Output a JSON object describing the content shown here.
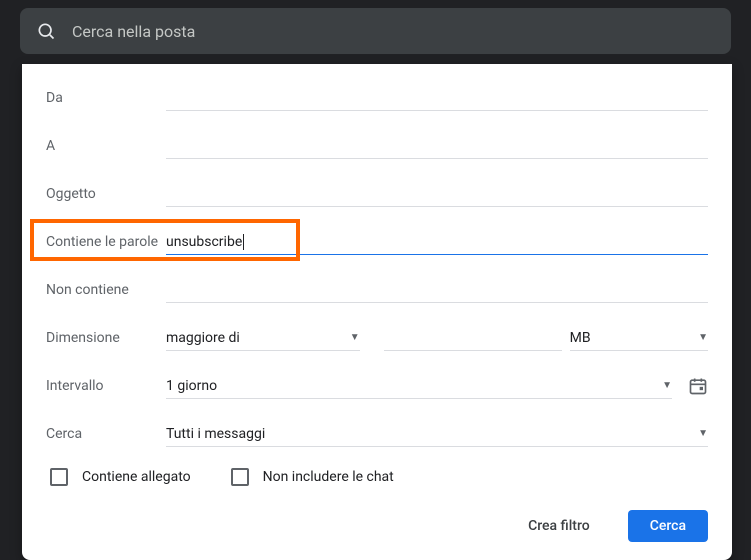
{
  "search": {
    "placeholder": "Cerca nella posta"
  },
  "form": {
    "from": {
      "label": "Da",
      "value": ""
    },
    "to": {
      "label": "A",
      "value": ""
    },
    "subject": {
      "label": "Oggetto",
      "value": ""
    },
    "has_words": {
      "label": "Contiene le parole",
      "value": "unsubscribe"
    },
    "not_has": {
      "label": "Non contiene",
      "value": ""
    },
    "size": {
      "label": "Dimensione",
      "operator": "maggiore di",
      "value": "",
      "unit": "MB"
    },
    "interval": {
      "label": "Intervallo",
      "value": "1 giorno"
    },
    "search_in": {
      "label": "Cerca",
      "value": "Tutti i messaggi"
    },
    "has_attachment": {
      "label": "Contiene allegato",
      "checked": false
    },
    "exclude_chat": {
      "label": "Non includere le chat",
      "checked": false
    }
  },
  "buttons": {
    "create_filter": "Crea filtro",
    "search": "Cerca"
  }
}
